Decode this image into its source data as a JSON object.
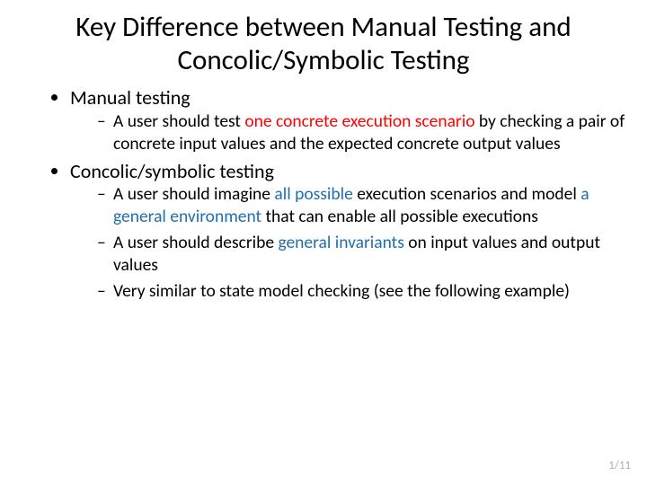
{
  "title": "Key Difference between Manual Testing and Concolic/Symbolic  Testing",
  "b1": {
    "label": "Manual testing",
    "s1_a": "A user should test ",
    "s1_red": "one concrete execution scenario",
    "s1_b": " by checking a pair of concrete input values and the expected concrete output values"
  },
  "b2": {
    "label": "Concolic/symbolic testing",
    "s1_a": "A user should imagine ",
    "s1_blue1": "all possible",
    "s1_b": " execution scenarios and model ",
    "s1_blue2": "a general environment",
    "s1_c": " that can enable all possible executions",
    "s2_a": "A user should describe ",
    "s2_blue": "general invariants",
    "s2_b": " on input values and output values",
    "s3": "Very similar to state model checking (see the following example)"
  },
  "page": "1/11"
}
